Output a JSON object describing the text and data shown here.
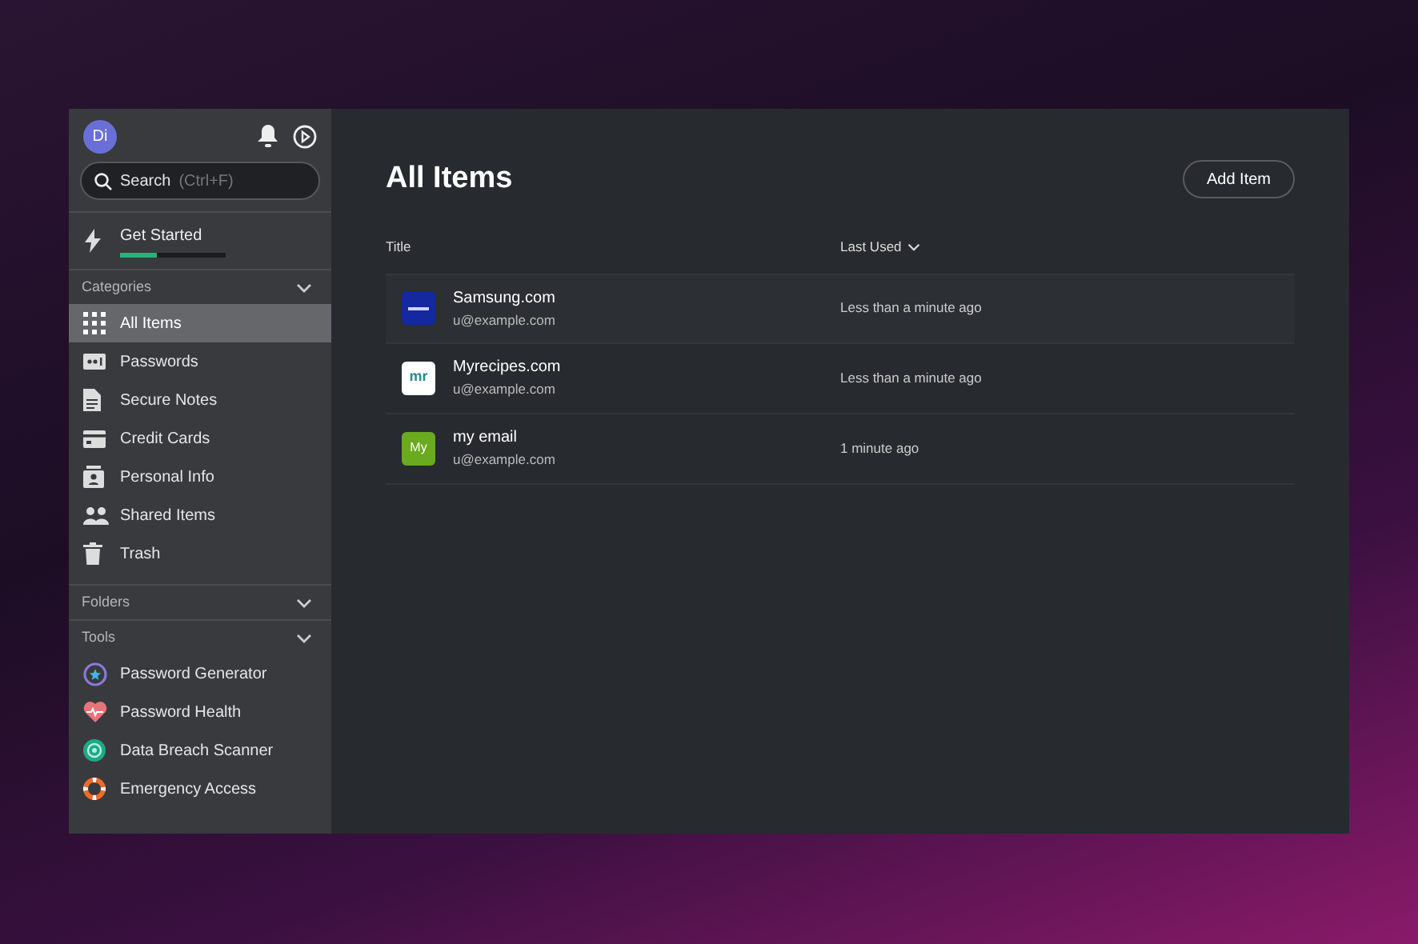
{
  "sidebar": {
    "avatar": "Di",
    "search": {
      "placeholder": "Search",
      "shortcut": "(Ctrl+F)"
    },
    "get_started": {
      "label": "Get Started",
      "level": 0.35
    },
    "categories": {
      "label": "Categories",
      "expanded": true,
      "items": [
        {
          "label": "All Items",
          "kind": "grid",
          "selected": true
        },
        {
          "label": "Passwords",
          "kind": "password",
          "selected": false
        },
        {
          "label": "Secure Notes",
          "kind": "note",
          "selected": false
        },
        {
          "label": "Credit Cards",
          "kind": "card",
          "selected": false
        },
        {
          "label": "Personal Info",
          "kind": "person",
          "selected": false
        },
        {
          "label": "Shared Items",
          "kind": "people",
          "selected": false
        },
        {
          "label": "Trash",
          "kind": "trash",
          "selected": false
        }
      ]
    },
    "folders": {
      "label": "Folders",
      "expanded": true
    },
    "tools": {
      "label": "Tools",
      "expanded": true,
      "items": [
        {
          "label": "Password Generator",
          "kind": "generator"
        },
        {
          "label": "Password Health",
          "kind": "health"
        },
        {
          "label": "Data Breach Scanner",
          "kind": "scanner"
        },
        {
          "label": "Emergency Access",
          "kind": "lifebuoy"
        }
      ]
    }
  },
  "main": {
    "title": "All Items",
    "add_button": "Add Item",
    "columns": [
      "Title",
      "Last Used"
    ],
    "rows": [
      {
        "title": "Samsung.com",
        "user": "u@example.com",
        "last_used": "Less than a minute ago",
        "kind": "samsung",
        "selected": true
      },
      {
        "title": "Myrecipes.com",
        "user": "u@example.com",
        "last_used": "Less than a minute ago",
        "logo": "mr",
        "kind": "myrecipes",
        "selected": false
      },
      {
        "title": "my email",
        "user": "u@example.com",
        "last_used": "1 minute ago",
        "logo": "My",
        "kind": "letter",
        "selected": false
      }
    ]
  }
}
